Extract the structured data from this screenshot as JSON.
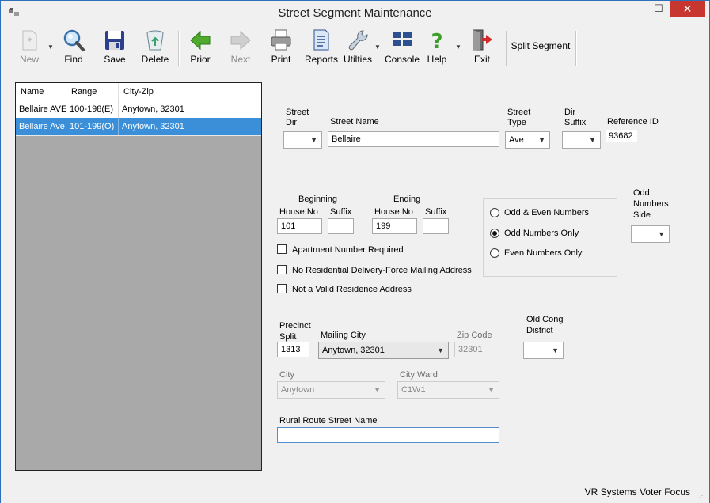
{
  "window": {
    "title": "Street Segment Maintenance",
    "minimize": "—",
    "maximize": "☐",
    "close": "✕"
  },
  "toolbar": {
    "new": "New",
    "find": "Find",
    "save": "Save",
    "delete": "Delete",
    "prior": "Prior",
    "next": "Next",
    "print": "Print",
    "reports": "Reports",
    "utilities": "Utilties",
    "console": "Console",
    "help": "Help",
    "exit": "Exit",
    "split_segment": "Split Segment"
  },
  "grid": {
    "columns": [
      "Name",
      "Range",
      "City-Zip"
    ],
    "rows": [
      {
        "name": "Bellaire AVE",
        "range": "100-198(E)",
        "city_zip": "Anytown, 32301"
      },
      {
        "name": "Bellaire Ave",
        "range": "101-199(O)",
        "city_zip": "Anytown, 32301"
      }
    ]
  },
  "form": {
    "street_dir_label_1": "Street",
    "street_dir_label_2": "Dir",
    "street_dir_value": "",
    "street_name_label": "Street Name",
    "street_name_value": "Bellaire",
    "street_type_label_1": "Street",
    "street_type_label_2": "Type",
    "street_type_value": "Ave",
    "dir_suffix_label_1": "Dir",
    "dir_suffix_label_2": "Suffix",
    "dir_suffix_value": "",
    "reference_id_label": "Reference ID",
    "reference_id_value": "93682",
    "beginning_label": "Beginning",
    "ending_label": "Ending",
    "house_no_label": "House No",
    "suffix_label": "Suffix",
    "beginning_house_no": "101",
    "beginning_suffix": "",
    "ending_house_no": "199",
    "ending_suffix": "",
    "odd_even_options": [
      {
        "label": "Odd & Even Numbers",
        "selected": false
      },
      {
        "label": "Odd Numbers Only",
        "selected": true
      },
      {
        "label": "Even Numbers Only",
        "selected": false
      }
    ],
    "odd_side_label_1": "Odd",
    "odd_side_label_2": "Numbers",
    "odd_side_label_3": "Side",
    "odd_side_value": "",
    "apartment_label": "Apartment Number Required",
    "apartment_checked": false,
    "no_residential_label": "No Residential Delivery-Force Mailing Address",
    "no_residential_checked": false,
    "not_valid_label": "Not a Valid Residence Address",
    "not_valid_checked": false,
    "precinct_label_1": "Precinct",
    "precinct_label_2": "Split",
    "precinct_value": "1313",
    "mailing_city_label": "Mailing City",
    "mailing_city_value": "Anytown, 32301",
    "zip_code_label": "Zip Code",
    "zip_code_value": "32301",
    "old_cong_label_1": "Old Cong",
    "old_cong_label_2": "District",
    "old_cong_value": "",
    "city_label": "City",
    "city_value": "Anytown",
    "city_ward_label": "City Ward",
    "city_ward_value": "C1W1",
    "rural_route_label": "Rural Route Street Name",
    "rural_route_value": ""
  },
  "status": {
    "text": "VR Systems Voter Focus"
  },
  "colors": {
    "selection": "#3b8fd8",
    "close_button": "#c7372f",
    "window_border": "#2f6fb8"
  }
}
